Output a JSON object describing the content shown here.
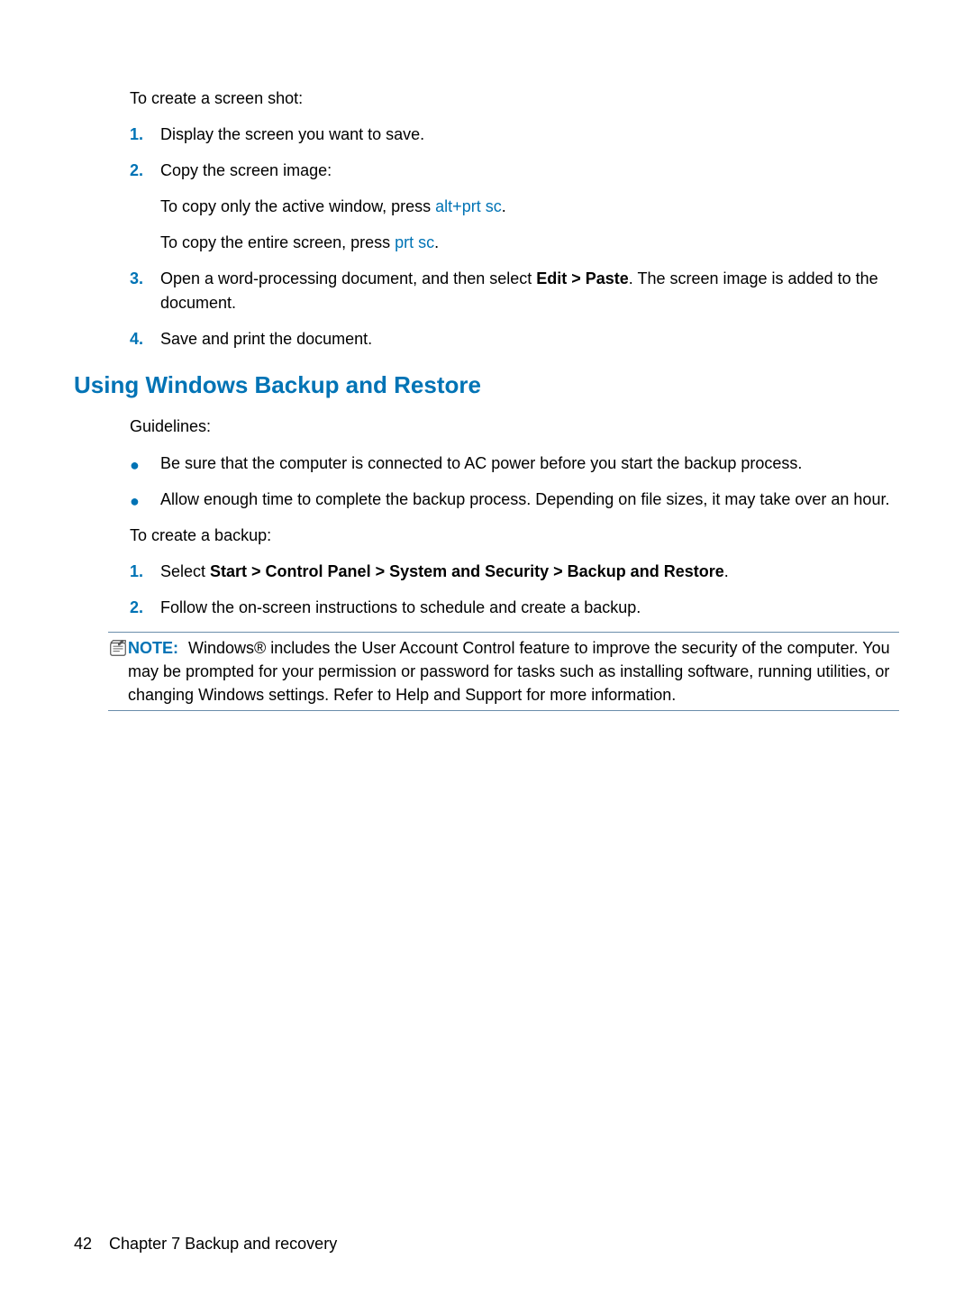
{
  "section1": {
    "intro": "To create a screen shot:",
    "steps": [
      {
        "num": "1.",
        "text": "Display the screen you want to save."
      },
      {
        "num": "2.",
        "text": "Copy the screen image:",
        "sub": [
          {
            "prefix": "To copy only the active window, press ",
            "key1": "alt",
            "plus": "+",
            "key2": "prt sc",
            "suffix": "."
          },
          {
            "prefix": "To copy the entire screen, press ",
            "key1": "prt sc",
            "suffix": "."
          }
        ]
      },
      {
        "num": "3.",
        "prefix": "Open a word-processing document, and then select ",
        "bold": "Edit > Paste",
        "suffix": ". The screen image is added to the document."
      },
      {
        "num": "4.",
        "text": "Save and print the document."
      }
    ]
  },
  "heading": "Using Windows Backup and Restore",
  "section2": {
    "intro": "Guidelines:",
    "bullets": [
      "Be sure that the computer is connected to AC power before you start the backup process.",
      "Allow enough time to complete the backup process. Depending on file sizes, it may take over an hour."
    ],
    "intro2": "To create a backup:",
    "steps": [
      {
        "num": "1.",
        "prefix": "Select ",
        "bold": "Start > Control Panel > System and Security > Backup and Restore",
        "suffix": "."
      },
      {
        "num": "2.",
        "text": "Follow the on-screen instructions to schedule and create a backup."
      }
    ]
  },
  "note": {
    "label": "NOTE:",
    "text": "Windows® includes the User Account Control feature to improve the security of the computer. You may be prompted for your permission or password for tasks such as installing software, running utilities, or changing Windows settings. Refer to Help and Support for more information."
  },
  "footer": {
    "pageNum": "42",
    "chapter": "Chapter 7   Backup and recovery"
  }
}
